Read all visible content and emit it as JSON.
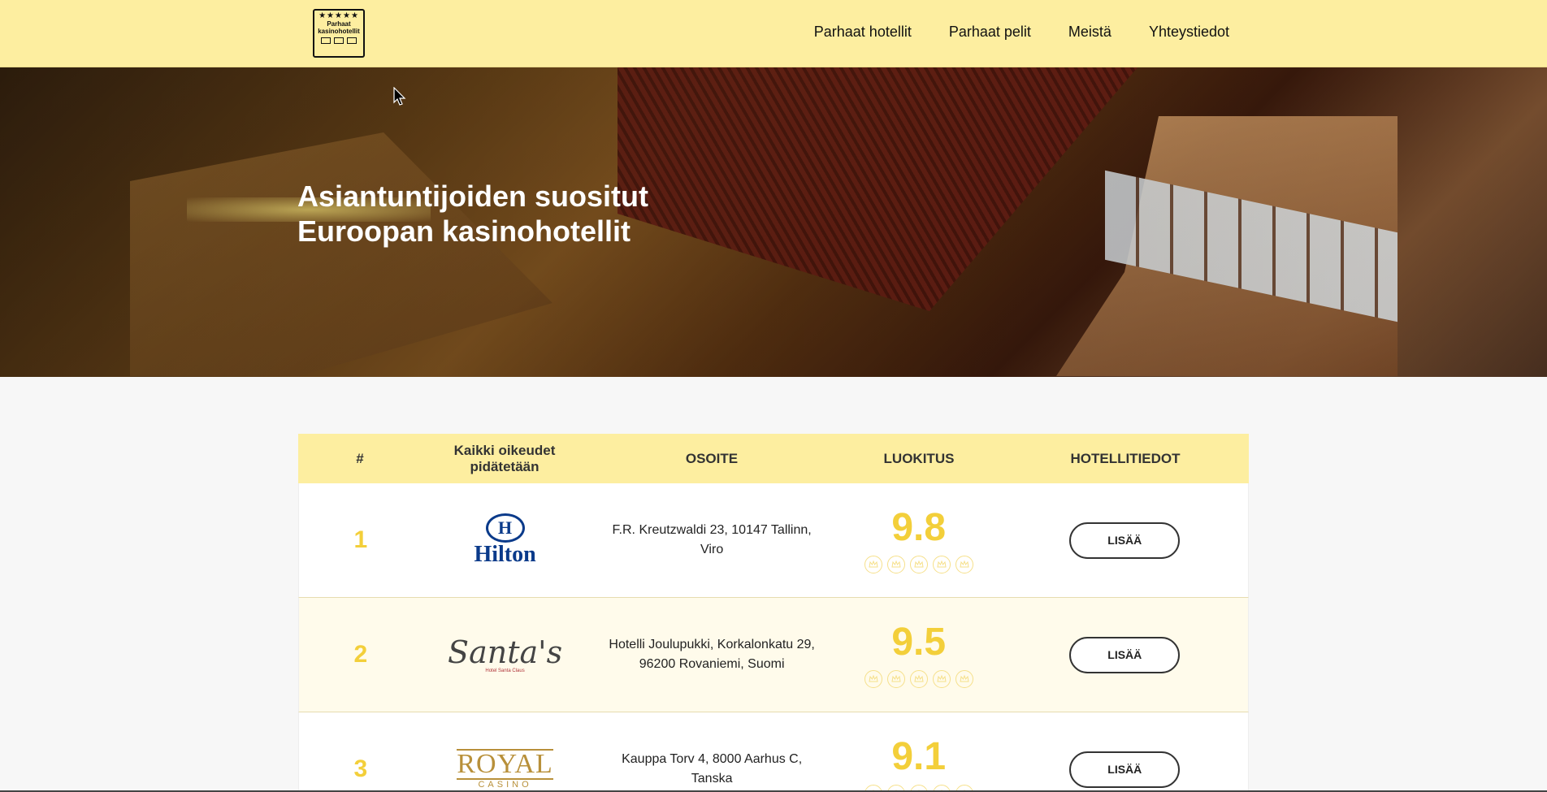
{
  "header": {
    "logo": {
      "stars": "★★★★★",
      "text": "Parhaat kasinohotellit"
    },
    "nav": [
      {
        "label": "Parhaat hotellit"
      },
      {
        "label": "Parhaat pelit"
      },
      {
        "label": "Meistä"
      },
      {
        "label": "Yhteystiedot"
      }
    ]
  },
  "hero": {
    "title_line1": "Asiantuntijoiden suositut",
    "title_line2": "Euroopan kasinohotellit"
  },
  "table": {
    "columns": [
      "#",
      "Kaikki oikeudet pidätetään",
      "OSOITE",
      "LUOKITUS",
      "HOTELLITIEDOT"
    ],
    "rows": [
      {
        "rank": "1",
        "logo_text": "Hilton",
        "address": "F.R. Kreutzwaldi 23, 10147 Tallinn, Viro",
        "score": "9.8",
        "button": "LISÄÄ"
      },
      {
        "rank": "2",
        "logo_text": "Santa's",
        "logo_sub": "Hotel Santa Claus",
        "address": "Hotelli Joulupukki, Korkalonkatu 29, 96200 Rovaniemi, Suomi",
        "score": "9.5",
        "button": "LISÄÄ"
      },
      {
        "rank": "3",
        "logo_text": "ROYAL",
        "logo_sub": "CASINO",
        "address": "Kauppa Torv 4, 8000 Aarhus C, Tanska",
        "score": "9.1",
        "button": "LISÄÄ"
      }
    ]
  },
  "colors": {
    "accent": "#fdeea0",
    "score": "#f3cf3a"
  }
}
